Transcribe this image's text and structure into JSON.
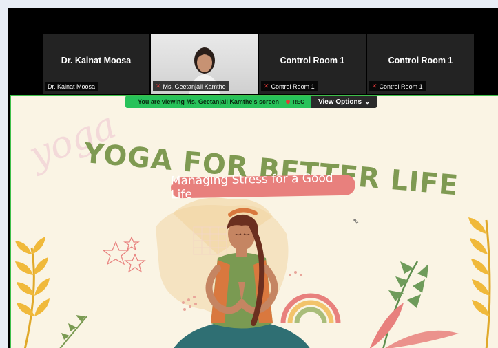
{
  "participants": [
    {
      "name": "Dr. Kainat Moosa",
      "caption": "Dr. Kainat Moosa",
      "muted": false,
      "video": false
    },
    {
      "name": "Ms. Geetanjali Kamthe",
      "caption": "Ms. Geetanjali Kamthe",
      "muted": true,
      "video": true
    },
    {
      "name": "Control Room 1",
      "caption": "Control Room 1",
      "muted": true,
      "video": false
    },
    {
      "name": "Control Room 1",
      "caption": "Control Room 1",
      "muted": true,
      "video": false
    }
  ],
  "share_banner": {
    "status_text": "You are viewing  Ms. Geetanjali Kamthe's screen",
    "rec_label": "REC",
    "view_options_label": "View Options"
  },
  "slide": {
    "title": "YOGA FOR BETTER LIFE",
    "subtitle": "Managing Stress for a Good Life",
    "watermark": "yoga"
  },
  "colors": {
    "accent_green": "#27c25a",
    "slide_bg": "#faf4e4",
    "title_green": "#7f9a52",
    "pill_coral": "#e8807d"
  }
}
